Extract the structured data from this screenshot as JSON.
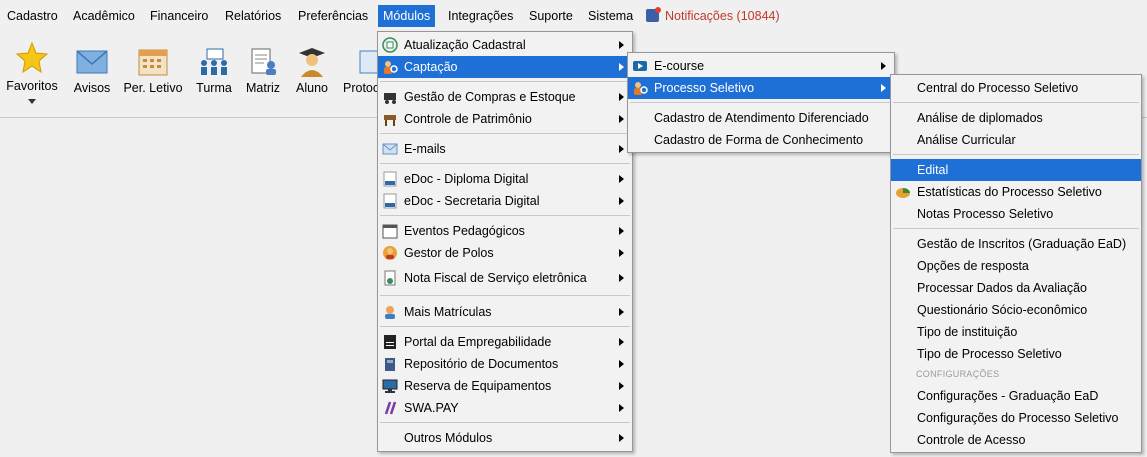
{
  "menubar": {
    "items": [
      "Cadastro",
      "Acadêmico",
      "Financeiro",
      "Relatórios",
      "Preferências",
      "Módulos",
      "Integrações",
      "Suporte",
      "Sistema"
    ],
    "notifications": "Notificações (10844)"
  },
  "toolbar": {
    "buttons": [
      {
        "label": "Favoritos",
        "icon": "star-icon"
      },
      {
        "label": "Avisos",
        "icon": "envelope-icon"
      },
      {
        "label": "Per. Letivo",
        "icon": "calendar-icon"
      },
      {
        "label": "Turma",
        "icon": "classroom-icon"
      },
      {
        "label": "Matriz",
        "icon": "document-user-icon"
      },
      {
        "label": "Aluno",
        "icon": "student-icon"
      },
      {
        "label": "Protoc",
        "icon": "protocol-icon"
      }
    ]
  },
  "modulos_menu": {
    "items": [
      {
        "label": "Atualização Cadastral",
        "icon": "refresh-icon"
      },
      {
        "label": "Captação",
        "icon": "people-search-icon"
      },
      {
        "label": "Gestão de Compras e Estoque",
        "icon": "cart-icon"
      },
      {
        "label": "Controle de Patrimônio",
        "icon": "furniture-icon"
      },
      {
        "label": "E-mails",
        "icon": "email-icon"
      },
      {
        "label": "eDoc - Diploma Digital",
        "icon": "edoc-icon"
      },
      {
        "label": "eDoc - Secretaria Digital",
        "icon": "edoc-icon"
      },
      {
        "label": "Eventos Pedagógicos",
        "icon": "calendar-event-icon"
      },
      {
        "label": "Gestor de Polos",
        "icon": "manager-icon"
      },
      {
        "label": "Nota Fiscal de Serviço eletrônica",
        "icon": "invoice-icon"
      },
      {
        "label": "Mais Matrículas",
        "icon": "enroll-icon"
      },
      {
        "label": "Portal da Empregabilidade",
        "icon": "cv-icon"
      },
      {
        "label": "Repositório de Documentos",
        "icon": "repository-icon"
      },
      {
        "label": "Reserva de Equipamentos",
        "icon": "monitor-icon"
      },
      {
        "label": "SWA.PAY",
        "icon": "swapay-icon"
      },
      {
        "label": "Outros Módulos",
        "icon": ""
      }
    ]
  },
  "captacao_menu": {
    "items": [
      {
        "label": "E-course",
        "icon": "ecourse-icon"
      },
      {
        "label": "Processo Seletivo",
        "icon": "people-search-icon"
      },
      {
        "label": "Cadastro de Atendimento Diferenciado",
        "icon": ""
      },
      {
        "label": "Cadastro de Forma de Conhecimento",
        "icon": ""
      }
    ]
  },
  "processo_menu": {
    "items": [
      "Central do Processo Seletivo",
      "Análise de diplomados",
      "Análise Curricular",
      "Edital",
      "Estatísticas do Processo Seletivo",
      "Notas Processo Seletivo",
      "Gestão de Inscritos (Graduação EaD)",
      "Opções de resposta",
      "Processar Dados da Avaliação",
      "Questionário Sócio-econômico",
      "Tipo de instituição",
      "Tipo de Processo Seletivo"
    ],
    "section": "CONFIGURAÇÕES",
    "config_items": [
      "Configurações - Graduação EaD",
      "Configurações do Processo Seletivo",
      "Controle de Acesso"
    ]
  },
  "colors": {
    "highlight": "#1e6fd6",
    "notification": "#c0392b"
  }
}
